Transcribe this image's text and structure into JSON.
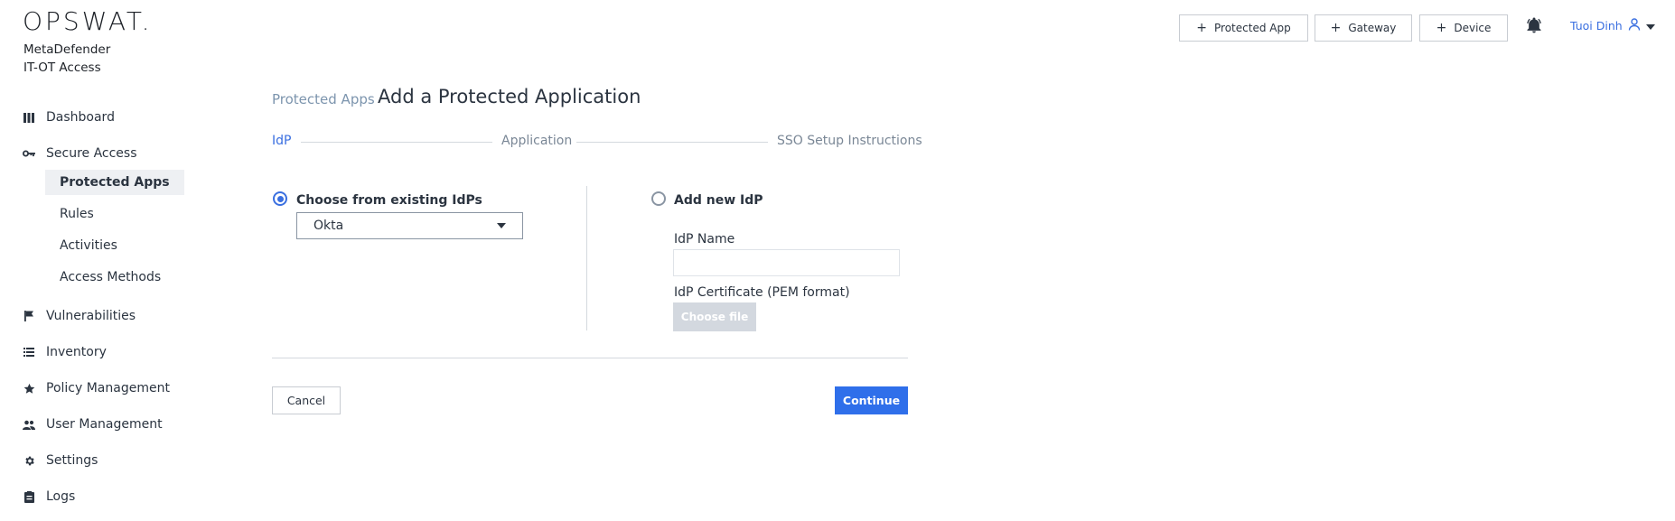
{
  "brand": {
    "logo": "OPSWAT.",
    "product_line1": "MetaDefender",
    "product_line2": "IT-OT Access"
  },
  "sidebar": {
    "items": [
      {
        "label": "Dashboard",
        "icon": "dashboard-icon"
      },
      {
        "label": "Secure Access",
        "icon": "key-icon"
      },
      {
        "label": "Vulnerabilities",
        "icon": "flag-icon"
      },
      {
        "label": "Inventory",
        "icon": "list-icon"
      },
      {
        "label": "Policy Management",
        "icon": "star-icon"
      },
      {
        "label": "User Management",
        "icon": "users-icon"
      },
      {
        "label": "Settings",
        "icon": "gear-icon"
      },
      {
        "label": "Logs",
        "icon": "clipboard-icon"
      }
    ],
    "secure_access_sub": [
      {
        "label": "Protected Apps",
        "active": true
      },
      {
        "label": "Rules"
      },
      {
        "label": "Activities"
      },
      {
        "label": "Access Methods"
      }
    ]
  },
  "header": {
    "buttons": [
      "Protected App",
      "Gateway",
      "Device"
    ],
    "user_name": "Tuoi Dinh"
  },
  "main": {
    "breadcrumb": "Protected Apps",
    "title": "Add a Protected Application",
    "steps": [
      "IdP",
      "Application",
      "SSO Setup Instructions"
    ],
    "active_step": "IdP",
    "option_existing": "Choose from existing IdPs",
    "existing_selected": "Okta",
    "option_new": "Add new IdP",
    "idp_name_label": "IdP Name",
    "idp_name_value": "",
    "idp_cert_label": "IdP Certificate (PEM format)",
    "choose_file": "Choose file",
    "cancel": "Cancel",
    "continue": "Continue"
  },
  "colors": {
    "accent": "#3a6fe0",
    "primary_button": "#2f6fea",
    "disabled_button": "#d3d8df"
  }
}
